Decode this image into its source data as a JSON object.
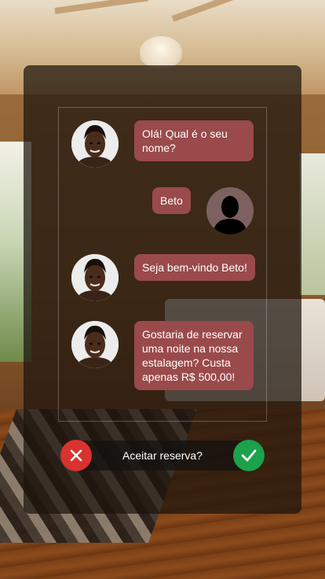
{
  "chat": {
    "messages": [
      {
        "from": "host",
        "text": "Olá! Qual é o seu nome?"
      },
      {
        "from": "user",
        "text": "Beto"
      },
      {
        "from": "host",
        "text": "Seja bem-vindo Beto!"
      },
      {
        "from": "host",
        "text": "Gostaria de reservar uma noite na nossa estalagem? Custa apenas R$ 500,00!"
      }
    ]
  },
  "prompt": {
    "question": "Aceitar reserva?",
    "reject_icon": "close-icon",
    "accept_icon": "check-icon"
  },
  "colors": {
    "bubble": "#9a4a4a",
    "reject": "#d9322f",
    "accept": "#1ba24a"
  }
}
